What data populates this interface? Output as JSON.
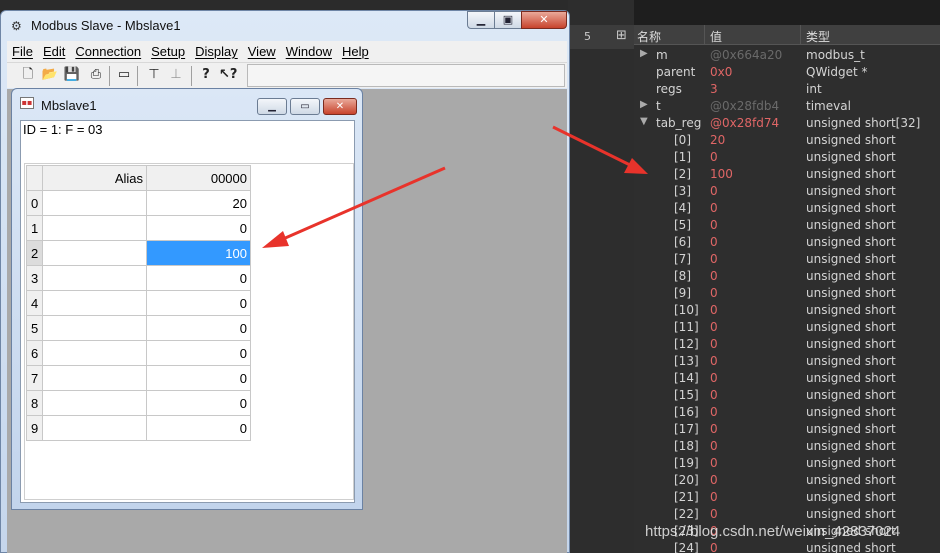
{
  "main_window": {
    "title": "Modbus Slave - Mbslave1",
    "menu": [
      "File",
      "Edit",
      "Connection",
      "Setup",
      "Display",
      "View",
      "Window",
      "Help"
    ]
  },
  "child_window": {
    "title": "Mbslave1",
    "id_line": "ID = 1: F = 03",
    "columns": {
      "alias": "Alias",
      "address": "00000"
    },
    "rows": [
      {
        "index": "0",
        "value": "20"
      },
      {
        "index": "1",
        "value": "0"
      },
      {
        "index": "2",
        "value": "100"
      },
      {
        "index": "3",
        "value": "0"
      },
      {
        "index": "4",
        "value": "0"
      },
      {
        "index": "5",
        "value": "0"
      },
      {
        "index": "6",
        "value": "0"
      },
      {
        "index": "7",
        "value": "0"
      },
      {
        "index": "8",
        "value": "0"
      },
      {
        "index": "9",
        "value": "0"
      }
    ]
  },
  "gap_strip_label": "5",
  "debugger": {
    "headers": {
      "name": "名称",
      "value": "值",
      "type": "类型"
    },
    "members": [
      {
        "name": "m",
        "value": "@0x664a20",
        "type": "modbus_t",
        "expand": "▶"
      },
      {
        "name": "parent",
        "value": "0x0",
        "type": "QWidget *",
        "expand": ""
      },
      {
        "name": "regs",
        "value": "3",
        "type": "int",
        "expand": ""
      },
      {
        "name": "t",
        "value": "@0x28fdb4",
        "type": "timeval",
        "expand": "▶"
      },
      {
        "name": "tab_reg",
        "value": "@0x28fd74",
        "type": "unsigned short[32]",
        "expand": "▼"
      }
    ],
    "elements": [
      {
        "name": "[0]",
        "value": "20",
        "type": "unsigned short"
      },
      {
        "name": "[1]",
        "value": "0",
        "type": "unsigned short"
      },
      {
        "name": "[2]",
        "value": "100",
        "type": "unsigned short"
      },
      {
        "name": "[3]",
        "value": "0",
        "type": "unsigned short"
      },
      {
        "name": "[4]",
        "value": "0",
        "type": "unsigned short"
      },
      {
        "name": "[5]",
        "value": "0",
        "type": "unsigned short"
      },
      {
        "name": "[6]",
        "value": "0",
        "type": "unsigned short"
      },
      {
        "name": "[7]",
        "value": "0",
        "type": "unsigned short"
      },
      {
        "name": "[8]",
        "value": "0",
        "type": "unsigned short"
      },
      {
        "name": "[9]",
        "value": "0",
        "type": "unsigned short"
      },
      {
        "name": "[10]",
        "value": "0",
        "type": "unsigned short"
      },
      {
        "name": "[11]",
        "value": "0",
        "type": "unsigned short"
      },
      {
        "name": "[12]",
        "value": "0",
        "type": "unsigned short"
      },
      {
        "name": "[13]",
        "value": "0",
        "type": "unsigned short"
      },
      {
        "name": "[14]",
        "value": "0",
        "type": "unsigned short"
      },
      {
        "name": "[15]",
        "value": "0",
        "type": "unsigned short"
      },
      {
        "name": "[16]",
        "value": "0",
        "type": "unsigned short"
      },
      {
        "name": "[17]",
        "value": "0",
        "type": "unsigned short"
      },
      {
        "name": "[18]",
        "value": "0",
        "type": "unsigned short"
      },
      {
        "name": "[19]",
        "value": "0",
        "type": "unsigned short"
      },
      {
        "name": "[20]",
        "value": "0",
        "type": "unsigned short"
      },
      {
        "name": "[21]",
        "value": "0",
        "type": "unsigned short"
      },
      {
        "name": "[22]",
        "value": "0",
        "type": "unsigned short"
      },
      {
        "name": "[23]",
        "value": "0",
        "type": "unsigned short"
      },
      {
        "name": "[24]",
        "value": "0",
        "type": "unsigned short"
      }
    ]
  },
  "watermark": "https://blog.csdn.net/weixin_42837024",
  "colors": {
    "selection": "#3399ff",
    "debug_value": "#e06666",
    "arrow": "#e8332b"
  }
}
